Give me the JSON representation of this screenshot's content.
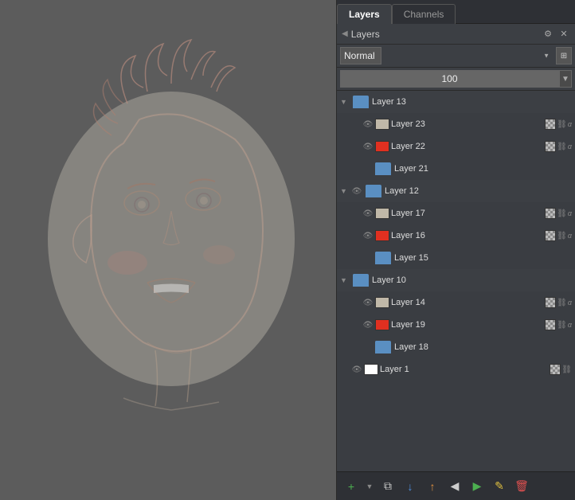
{
  "tabs": [
    {
      "id": "layers",
      "label": "Layers",
      "active": true
    },
    {
      "id": "channels",
      "label": "Channels",
      "active": false
    }
  ],
  "panel": {
    "title": "Layers",
    "blend_mode": "Normal",
    "opacity": "100"
  },
  "layers": [
    {
      "id": "layer13",
      "name": "Layer 13",
      "type": "group",
      "expanded": true,
      "indent": 0,
      "selected": false,
      "children": [
        {
          "id": "layer23",
          "name": "Layer 23",
          "type": "layer",
          "indent": 1,
          "selected": false,
          "has_icons": true
        },
        {
          "id": "layer22",
          "name": "Layer 22",
          "type": "layer",
          "indent": 1,
          "selected": false,
          "has_red": true,
          "has_icons": true
        },
        {
          "id": "layer21",
          "name": "Layer 21",
          "type": "layer",
          "indent": 2,
          "selected": false,
          "has_icons": false
        }
      ]
    },
    {
      "id": "layer12",
      "name": "Layer 12",
      "type": "group",
      "expanded": true,
      "indent": 0,
      "selected": true,
      "children": [
        {
          "id": "layer17",
          "name": "Layer 17",
          "type": "layer",
          "indent": 1,
          "selected": false,
          "has_icons": false
        },
        {
          "id": "layer16",
          "name": "Layer 16",
          "type": "layer",
          "indent": 1,
          "selected": false,
          "has_red": true,
          "has_icons": true
        },
        {
          "id": "layer15",
          "name": "Layer 15",
          "type": "layer",
          "indent": 2,
          "selected": false,
          "has_icons": false
        }
      ]
    },
    {
      "id": "layer10",
      "name": "Layer 10",
      "type": "group",
      "expanded": true,
      "indent": 0,
      "selected": false,
      "children": [
        {
          "id": "layer14",
          "name": "Layer 14",
          "type": "layer",
          "indent": 1,
          "selected": false,
          "has_icons": true
        },
        {
          "id": "layer19",
          "name": "Layer 19",
          "type": "layer",
          "indent": 1,
          "selected": false,
          "has_red": true,
          "has_icons": true
        },
        {
          "id": "layer18",
          "name": "Layer 18",
          "type": "layer",
          "indent": 2,
          "selected": false,
          "has_icons": false
        }
      ]
    },
    {
      "id": "layer1",
      "name": "Layer 1",
      "type": "layer",
      "indent": 0,
      "selected": false,
      "has_white": true,
      "has_icons": true
    }
  ],
  "toolbar": {
    "new_layer_label": "+",
    "duplicate_label": "⧉",
    "move_down_label": "↓",
    "move_up_label": "↑",
    "anchor_left_label": "◀",
    "anchor_right_label": "▶",
    "edit_label": "✎",
    "delete_label": "🗑"
  },
  "colors": {
    "accent_blue": "#5a7ba0",
    "folder_blue": "#5a8fc2",
    "green": "#4caf50",
    "red": "#e05050",
    "orange": "#e09040",
    "layer_red": "#e03020"
  }
}
